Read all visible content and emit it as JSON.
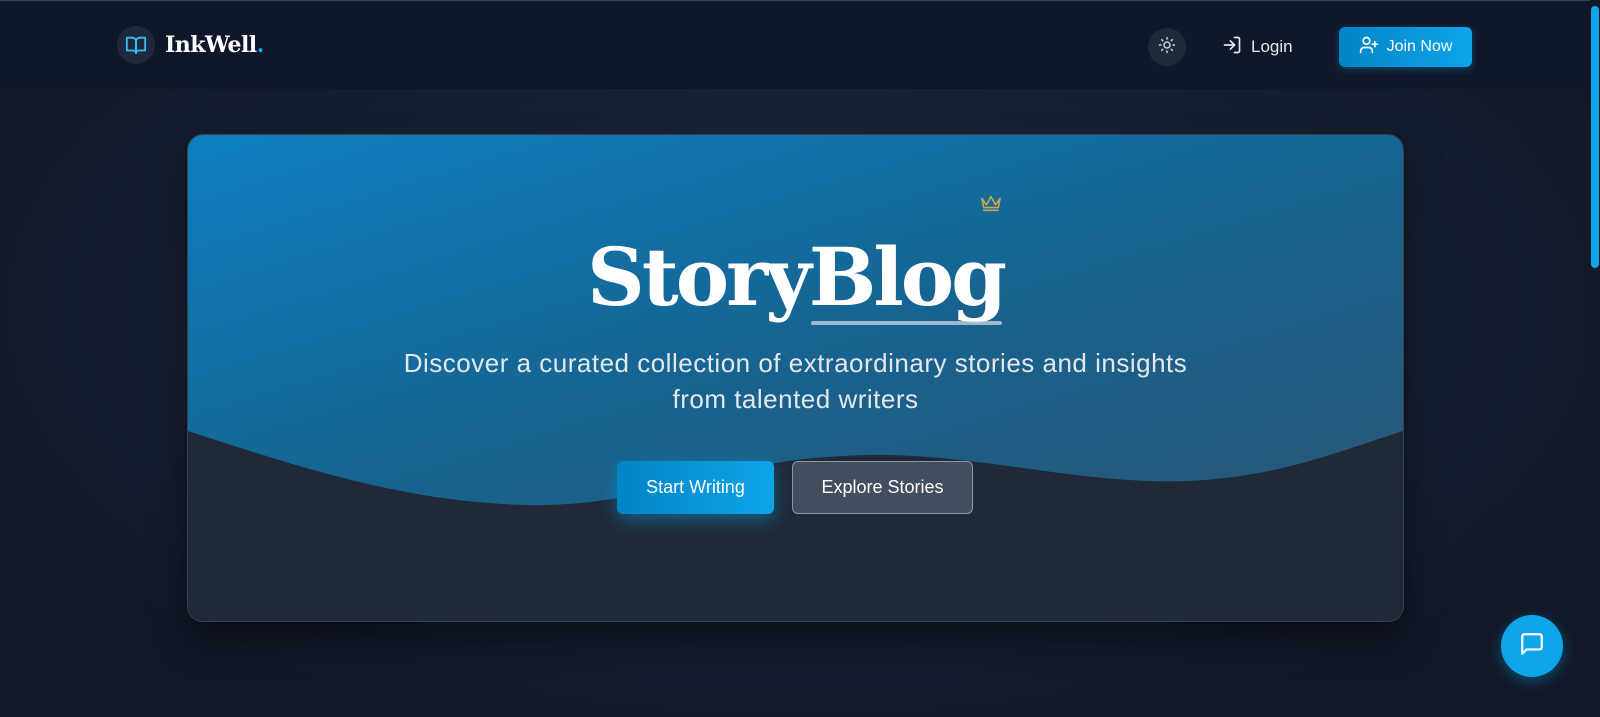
{
  "navbar": {
    "brand": {
      "name": "InkWell",
      "dot": ".",
      "icon": "book-open-icon"
    },
    "theme_toggle": {
      "icon": "sun-icon"
    },
    "login": {
      "label": "Login",
      "icon": "log-in-icon"
    },
    "join": {
      "label": "Join Now",
      "icon": "user-plus-icon"
    }
  },
  "hero": {
    "title_part1": "Story",
    "title_part2": "Blog",
    "crown_icon": "crown-icon",
    "subtitle": "Discover a curated collection of extraordinary stories and insights from talented writers",
    "primary_button": "Start Writing",
    "secondary_button": "Explore Stories"
  },
  "chat": {
    "icon": "message-square-icon"
  },
  "colors": {
    "accent": "#0ea5e9",
    "background": "#111827",
    "card": "#1f2937",
    "hero_gradient_start": "#0e7fc0",
    "crown": "#c9a84a"
  }
}
